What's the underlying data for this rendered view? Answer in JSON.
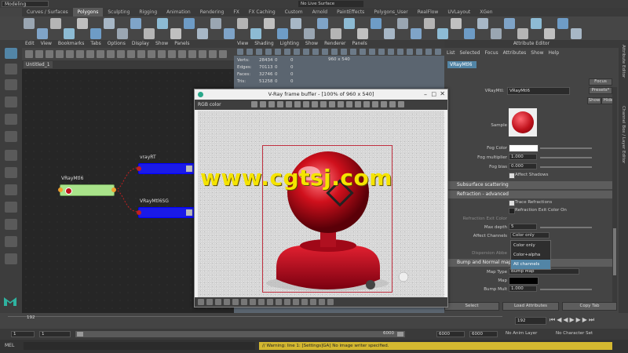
{
  "topbar": {
    "mode": "Modeling",
    "live_surface": "No Live Surface"
  },
  "shelf": {
    "tabs": [
      "Curves / Surfaces",
      "Polygons",
      "Sculpting",
      "Rigging",
      "Animation",
      "Rendering",
      "FX",
      "FX Caching",
      "Custom",
      "Arnold",
      "PaintEffects",
      "Polygons_User",
      "RealFlow",
      "UVLayout",
      "XGen"
    ],
    "active_index": 1
  },
  "hypershade": {
    "menu": [
      "Edit",
      "View",
      "Bookmarks",
      "Tabs",
      "Options",
      "Display",
      "Show",
      "Panels"
    ],
    "tab": "Untitled_1",
    "nodes": {
      "material": "VRayMtl6",
      "render": "vrayRT",
      "sg": "VRayMtl6SG"
    }
  },
  "viewport": {
    "menu": [
      "View",
      "Shading",
      "Lighting",
      "Show",
      "Renderer",
      "Panels"
    ],
    "hud": {
      "rows": [
        [
          "Verts:",
          "28434",
          "0",
          "0"
        ],
        [
          "Edges:",
          "70113",
          "0",
          "0"
        ],
        [
          "Faces:",
          "32746",
          "0",
          "0"
        ],
        [
          "Tris:",
          "51258",
          "0",
          "0"
        ]
      ],
      "resolution": "960 x 540"
    }
  },
  "vray": {
    "title": "V-Ray frame buffer - [100% of 960 x 540]",
    "channel": "RGB color"
  },
  "attr": {
    "title": "Attribute Editor",
    "menu": [
      "List",
      "Selected",
      "Focus",
      "Attributes",
      "Show",
      "Help"
    ],
    "tab": "VRayMtl6",
    "name_label": "VRayMtl:",
    "name_value": "VRayMtl6",
    "focus": "Focus",
    "presets": "Presets*",
    "show": "Show",
    "hide": "Hide",
    "sample": "Sample",
    "fog_color": "Fog Color",
    "fog_multiplier": "Fog multiplier",
    "fog_multiplier_val": "1.000",
    "fog_bias": "Fog bias",
    "fog_bias_val": "0.000",
    "affect_shadows": "Affect Shadows",
    "subsurface": "Subsurface scattering",
    "refraction_adv": "Refraction - advanced",
    "trace_refractions": "Trace Refractions",
    "refraction_exit": "Refraction Exit Color On",
    "refraction_exit_color": "Refraction Exit Color",
    "max_depth": "Max depth",
    "max_depth_val": "5",
    "affect_channels": "Affect Channels",
    "affect_value": "Color only",
    "dispersion": "Dispersion Abbe",
    "options": [
      "Color only",
      "Color+alpha",
      "All channels"
    ],
    "bump_section": "Bump and Normal mapping",
    "map_type": "Map Type",
    "map_type_val": "Bump Map",
    "map": "Map",
    "bump_mult": "Bump Mult",
    "bump_mult_val": "1.000",
    "select": "Select",
    "load": "Load Attributes",
    "copy": "Copy Tab"
  },
  "sidetabs": [
    "Attribute Editor",
    "Channel Box / Layer Editor"
  ],
  "timeline": {
    "current_frame": "192",
    "end_frame": "192"
  },
  "range": {
    "start": "1",
    "start2": "1",
    "mid": "1",
    "end": "6000",
    "end2": "6000",
    "end3": "6000",
    "anim_layer": "No Anim Layer",
    "char_set": "No Character Set"
  },
  "cmd": {
    "label": "MEL",
    "warning": "// Warning: line 1: [Settings]GA] No image writer specified."
  },
  "watermark": "www.cgtsj.com",
  "colors": {
    "accent": "#5285a6",
    "vray_red": "#c0121c",
    "watermark": "#f5e400"
  }
}
